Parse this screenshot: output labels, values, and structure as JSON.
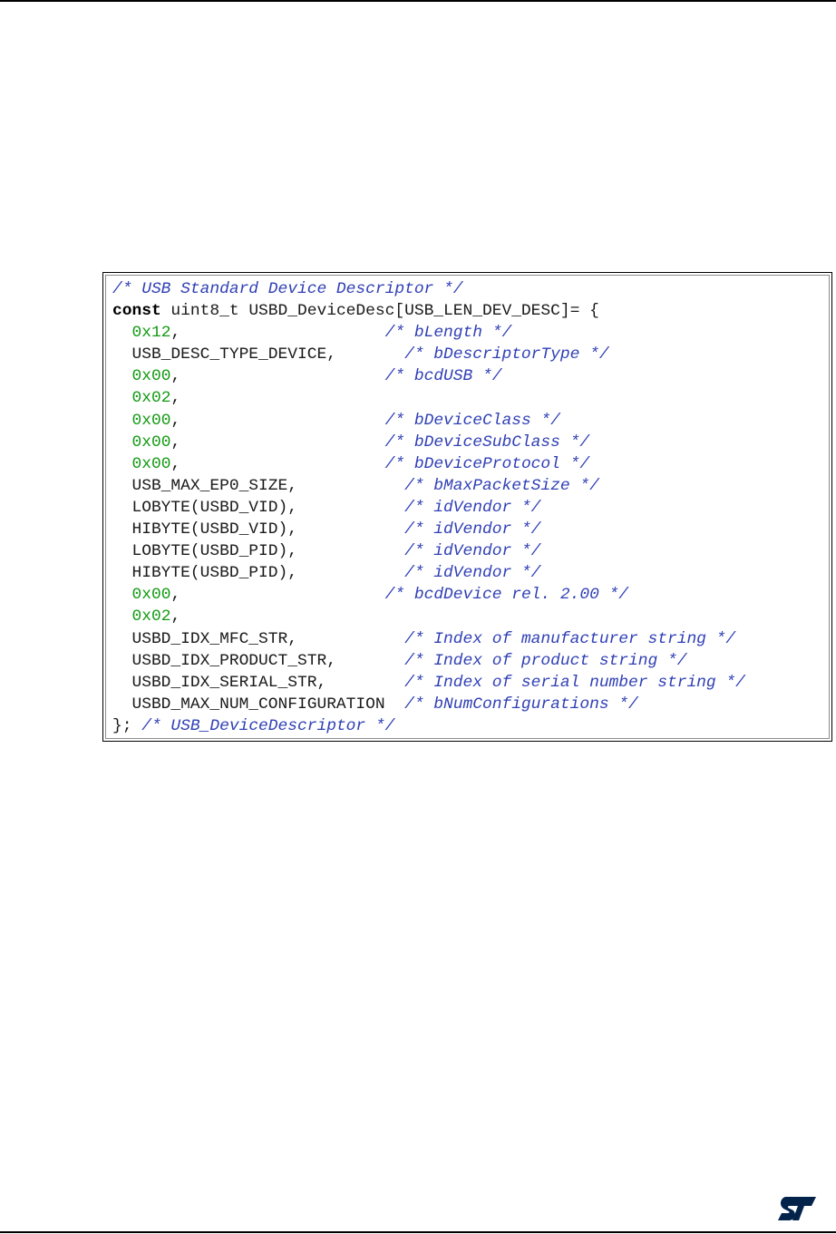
{
  "code": {
    "lines": [
      {
        "segments": [
          {
            "t": "/* USB Standard Device Descriptor */",
            "c": "cmt"
          }
        ]
      },
      {
        "segments": [
          {
            "t": "const",
            "c": "kw"
          },
          {
            "t": " uint8_t USBD_DeviceDesc[USB_LEN_DEV_DESC]= {",
            "c": "plain"
          }
        ]
      },
      {
        "segments": [
          {
            "t": "  ",
            "c": "plain"
          },
          {
            "t": "0x12",
            "c": "num"
          },
          {
            "t": ",                     ",
            "c": "plain"
          },
          {
            "t": "/* bLength */",
            "c": "cmt"
          }
        ]
      },
      {
        "segments": [
          {
            "t": "  USB_DESC_TYPE_DEVICE,       ",
            "c": "plain"
          },
          {
            "t": "/* bDescriptorType */",
            "c": "cmt"
          }
        ]
      },
      {
        "segments": [
          {
            "t": "  ",
            "c": "plain"
          },
          {
            "t": "0x00",
            "c": "num"
          },
          {
            "t": ",                     ",
            "c": "plain"
          },
          {
            "t": "/* bcdUSB */",
            "c": "cmt"
          }
        ]
      },
      {
        "segments": [
          {
            "t": "  ",
            "c": "plain"
          },
          {
            "t": "0x02",
            "c": "num"
          },
          {
            "t": ",",
            "c": "plain"
          }
        ]
      },
      {
        "segments": [
          {
            "t": "  ",
            "c": "plain"
          },
          {
            "t": "0x00",
            "c": "num"
          },
          {
            "t": ",                     ",
            "c": "plain"
          },
          {
            "t": "/* bDeviceClass */",
            "c": "cmt"
          }
        ]
      },
      {
        "segments": [
          {
            "t": "  ",
            "c": "plain"
          },
          {
            "t": "0x00",
            "c": "num"
          },
          {
            "t": ",                     ",
            "c": "plain"
          },
          {
            "t": "/* bDeviceSubClass */",
            "c": "cmt"
          }
        ]
      },
      {
        "segments": [
          {
            "t": "  ",
            "c": "plain"
          },
          {
            "t": "0x00",
            "c": "num"
          },
          {
            "t": ",                     ",
            "c": "plain"
          },
          {
            "t": "/* bDeviceProtocol */",
            "c": "cmt"
          }
        ]
      },
      {
        "segments": [
          {
            "t": "  USB_MAX_EP0_SIZE,           ",
            "c": "plain"
          },
          {
            "t": "/* bMaxPacketSize */",
            "c": "cmt"
          }
        ]
      },
      {
        "segments": [
          {
            "t": "  LOBYTE(USBD_VID),           ",
            "c": "plain"
          },
          {
            "t": "/* idVendor */",
            "c": "cmt"
          }
        ]
      },
      {
        "segments": [
          {
            "t": "  HIBYTE(USBD_VID),           ",
            "c": "plain"
          },
          {
            "t": "/* idVendor */",
            "c": "cmt"
          }
        ]
      },
      {
        "segments": [
          {
            "t": "  LOBYTE(USBD_PID),           ",
            "c": "plain"
          },
          {
            "t": "/* idVendor */",
            "c": "cmt"
          }
        ]
      },
      {
        "segments": [
          {
            "t": "  HIBYTE(USBD_PID),           ",
            "c": "plain"
          },
          {
            "t": "/* idVendor */",
            "c": "cmt"
          }
        ]
      },
      {
        "segments": [
          {
            "t": "  ",
            "c": "plain"
          },
          {
            "t": "0x00",
            "c": "num"
          },
          {
            "t": ",                     ",
            "c": "plain"
          },
          {
            "t": "/* bcdDevice rel. 2.00 */",
            "c": "cmt"
          }
        ]
      },
      {
        "segments": [
          {
            "t": "  ",
            "c": "plain"
          },
          {
            "t": "0x02",
            "c": "num"
          },
          {
            "t": ",",
            "c": "plain"
          }
        ]
      },
      {
        "segments": [
          {
            "t": "  USBD_IDX_MFC_STR,           ",
            "c": "plain"
          },
          {
            "t": "/* Index of manufacturer string */",
            "c": "cmt"
          }
        ]
      },
      {
        "segments": [
          {
            "t": "  USBD_IDX_PRODUCT_STR,       ",
            "c": "plain"
          },
          {
            "t": "/* Index of product string */",
            "c": "cmt"
          }
        ]
      },
      {
        "segments": [
          {
            "t": "  USBD_IDX_SERIAL_STR,        ",
            "c": "plain"
          },
          {
            "t": "/* Index of serial number string */",
            "c": "cmt"
          }
        ]
      },
      {
        "segments": [
          {
            "t": "  USBD_MAX_NUM_CONFIGURATION  ",
            "c": "plain"
          },
          {
            "t": "/* bNumConfigurations */",
            "c": "cmt"
          }
        ]
      },
      {
        "segments": [
          {
            "t": "}; ",
            "c": "plain"
          },
          {
            "t": "/* USB_DeviceDescriptor */",
            "c": "cmt"
          }
        ]
      }
    ]
  },
  "logo": {
    "name": "st-logo-icon",
    "color": "#03234b"
  },
  "colors": {
    "comment": "#2f3fb5",
    "number": "#139a13",
    "text": "#1a1a1a"
  }
}
